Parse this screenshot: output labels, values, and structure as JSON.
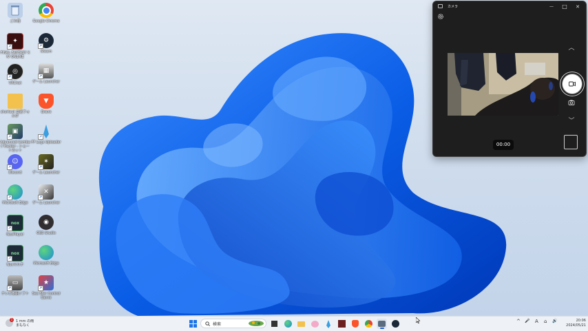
{
  "desktop": {
    "icons": [
      {
        "label": "ごみ箱",
        "icon": "recycle-bin-icon",
        "color": "#9fb8d8"
      },
      {
        "label": "Google Chrome",
        "icon": "chrome-icon",
        "color": "#ea4335"
      },
      {
        "label": "FINAL FANTASY XIV ONLINE",
        "icon": "ffxiv-icon",
        "color": "#8b1a1a"
      },
      {
        "label": "Steam",
        "icon": "steam-icon",
        "color": "#1b2838"
      },
      {
        "label": "VRChat",
        "icon": "vr-icon",
        "color": "#2b2b2b"
      },
      {
        "label": "ゲーム Launcher",
        "icon": "game-launcher-icon",
        "color": "#4a4a4a"
      },
      {
        "label": "shortcut 文書フォルダ",
        "icon": "folder-icon",
        "color": "#f2c14e"
      },
      {
        "label": "Brave",
        "icon": "brave-icon",
        "color": "#fb542b"
      },
      {
        "label": "Advanced Combat Tracker - ショートカット",
        "icon": "act-icon",
        "color": "#3d6b3d"
      },
      {
        "label": "FF Logs Uploader",
        "icon": "fflogs-icon",
        "color": "#2e8cc9"
      },
      {
        "label": "Discord",
        "icon": "discord-icon",
        "color": "#5865f2"
      },
      {
        "label": "ゲーム Launcher",
        "icon": "game-icon",
        "color": "#5a5a20"
      },
      {
        "label": "Microsoft Edge",
        "icon": "edge-icon",
        "color": "#1a8cd8"
      },
      {
        "label": "ゲーム Launcher",
        "icon": "game2-icon",
        "color": "#3a3a3a"
      },
      {
        "label": "NoxPlayer",
        "icon": "nox-icon",
        "color": "#2aa84a"
      },
      {
        "label": "OBS Studio",
        "icon": "obs-icon",
        "color": "#302e31"
      },
      {
        "label": "Noxマルチ",
        "icon": "nox-multi-icon",
        "color": "#238b3e"
      },
      {
        "label": "Microsoft Edge",
        "icon": "edge-icon",
        "color": "#1a8cd8"
      },
      {
        "label": "テレビ番組ソフト",
        "icon": "tv-icon",
        "color": "#555555"
      },
      {
        "label": "Sea Star Control Game",
        "icon": "seastar-icon",
        "color": "#2c6fd6"
      }
    ]
  },
  "camera_app": {
    "title": "カメラ",
    "timer": "00:00",
    "minimize_glyph": "—",
    "maximize_glyph": "□",
    "close_glyph": "✕",
    "chevron_up": "︿",
    "chevron_down": "﹀"
  },
  "taskbar": {
    "weather_temp": "1 mm の雨",
    "weather_desc": "まもなく",
    "weather_badge": "1",
    "search_label": "検索",
    "apps": [
      "start-icon",
      "file-explorer-icon",
      "edge-icon",
      "folder-icon",
      "pink-app-icon",
      "fflogs-icon",
      "ffxiv-icon",
      "brave-icon",
      "chrome-icon",
      "camera-icon",
      "steam-icon"
    ],
    "tray": {
      "chevron": "^",
      "mic": "🎤",
      "ime": "A",
      "network": "⌂",
      "volume": "🔊"
    },
    "clock_time": "20:06",
    "clock_date": "2024/05/21"
  },
  "colors": {
    "accent": "#1a5fd0",
    "window_bg": "#1e1e1e",
    "taskbar_bg": "#eef2f7"
  }
}
